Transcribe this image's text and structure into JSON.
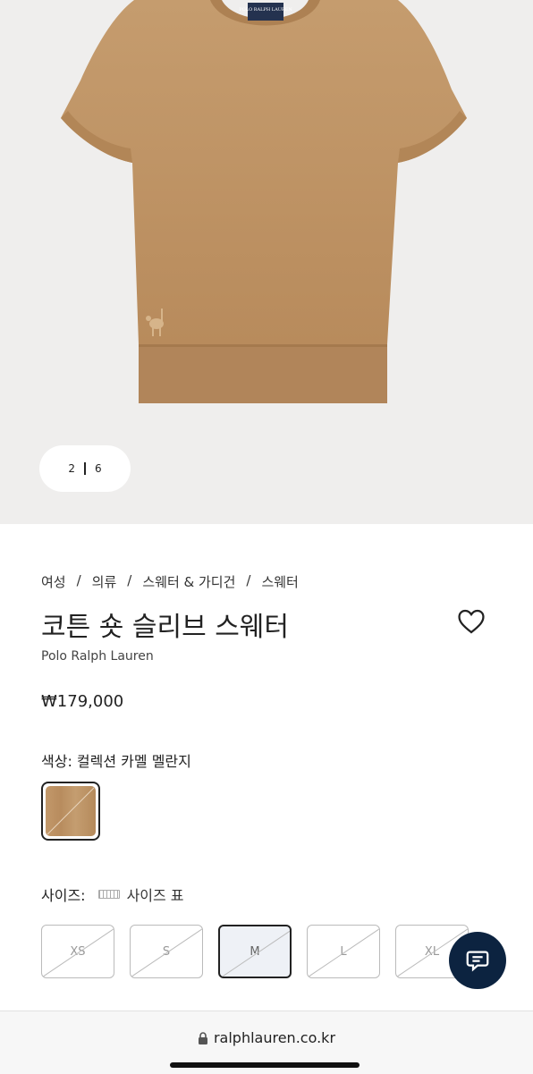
{
  "gallery": {
    "current": "2",
    "total": "6"
  },
  "breadcrumb": [
    "여성",
    "/",
    "의류",
    "/",
    "스웨터 & 가디건",
    "/",
    "스웨터"
  ],
  "product": {
    "title": "코튼 숏 슬리브 스웨터",
    "brand": "Polo Ralph Lauren",
    "price": "₩179,000",
    "color_label": "색상: 컬렉션 카멜 멜란지",
    "size_label": "사이즈:",
    "size_chart": "사이즈 표",
    "sizes": [
      "XS",
      "S",
      "M",
      "L",
      "XL"
    ],
    "selected_size": "M",
    "label_tag": "POLO RALPH LAUREN"
  },
  "browser": {
    "url": "ralphlauren.co.kr"
  },
  "icons": [
    "heart-icon",
    "chat-icon",
    "lock-icon",
    "ruler-icon"
  ],
  "colors": {
    "camel": "#b98c5d",
    "navy": "#0c2340"
  }
}
